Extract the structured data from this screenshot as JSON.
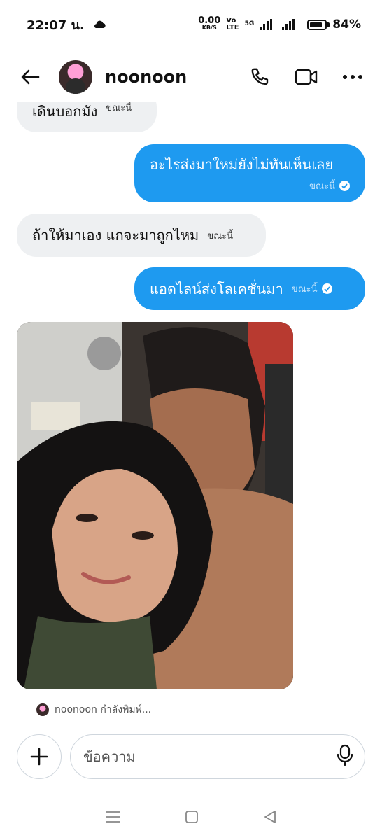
{
  "status": {
    "time": "22:07 น.",
    "net_speed": "0.00",
    "net_unit": "KB/S",
    "volte_top": "Vo",
    "volte_bottom": "LTE",
    "network": "5G",
    "battery": "84%",
    "battery_level": 0.84
  },
  "header": {
    "contact_name": "noonoon",
    "icons": [
      "back-arrow-icon",
      "avatar",
      "phone-icon",
      "video-icon",
      "more-icon"
    ]
  },
  "messages": [
    {
      "from": "them",
      "text": "เดินบอกมัง",
      "time": "ขณะนี้"
    },
    {
      "from": "me",
      "text": "อะไรส่งมาใหม่ยังไม่ทันเห็นเลย",
      "time": "ขณะนี้"
    },
    {
      "from": "them",
      "text": "ถ้าให้มาเอง แกจะมาถูกไหม",
      "time": "ขณะนี้"
    },
    {
      "from": "me",
      "text": "แอดไลน์ส่งโลเคชั่นมา",
      "time": "ขณะนี้"
    }
  ],
  "typing_indicator": "noonoon กำลังพิมพ์...",
  "composer": {
    "placeholder": "ข้อความ"
  },
  "colors": {
    "outgoing": "#1e9af0",
    "incoming": "#eef0f2"
  }
}
